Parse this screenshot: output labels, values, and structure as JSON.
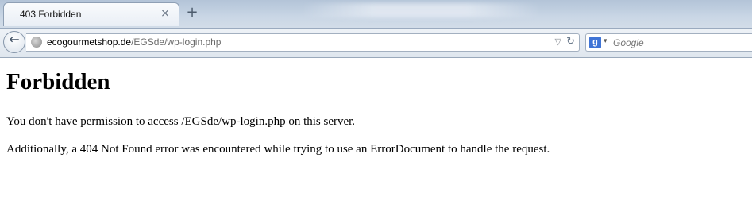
{
  "browser": {
    "tab": {
      "title": "403 Forbidden",
      "close_glyph": "×"
    },
    "new_tab_glyph": "+",
    "back_glyph": "←",
    "url": {
      "host": "ecogourmetshop.de",
      "path": "/EGSde/wp-login.php"
    },
    "search": {
      "engine_glyph": "g",
      "placeholder": "Google"
    }
  },
  "page": {
    "heading": "Forbidden",
    "message": "You don't have permission to access /EGSde/wp-login.php on this server.",
    "detail": "Additionally, a 404 Not Found error was encountered while trying to use an ErrorDocument to handle the request."
  },
  "icons": [
    "back-arrow-icon",
    "globe-icon",
    "dropmarker-icon",
    "reload-icon",
    "google-icon",
    "close-icon",
    "plus-icon"
  ],
  "colors": {
    "chrome": "#c9d6e5",
    "page_background": "#ffffff",
    "text": "#000000"
  }
}
